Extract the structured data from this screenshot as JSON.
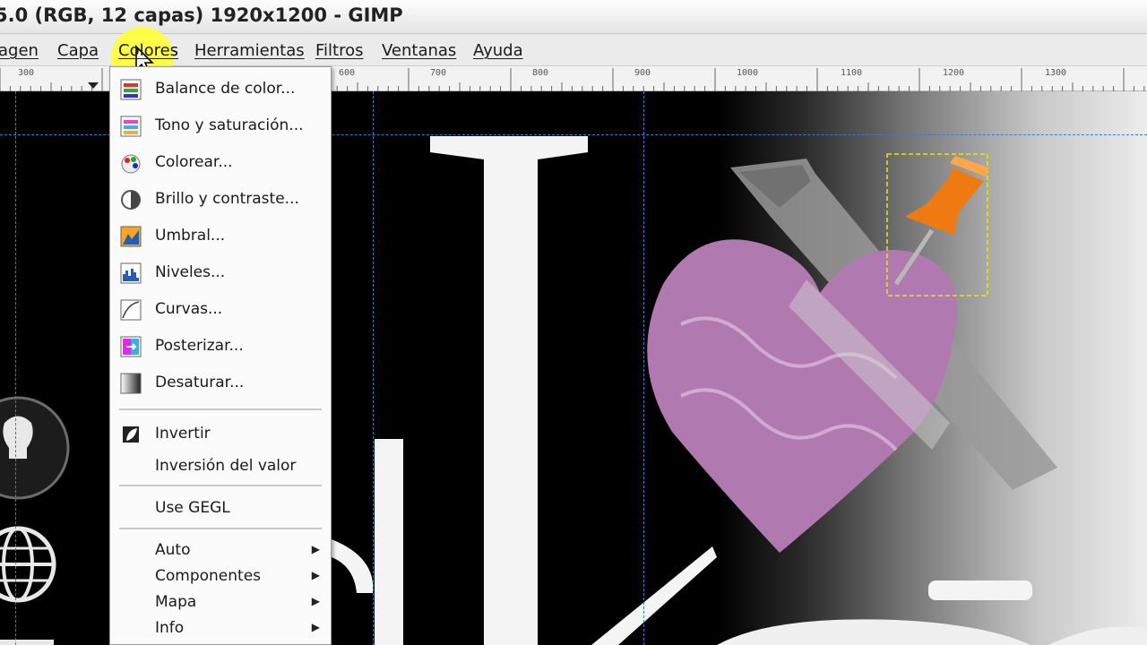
{
  "window": {
    "title": "5.0 (RGB, 12 capas) 1920x1200 - GIMP"
  },
  "menubar": {
    "items": [
      {
        "label": "agen"
      },
      {
        "label": "Capa"
      },
      {
        "label": "Colores"
      },
      {
        "label": "Herramientas"
      },
      {
        "label": "Filtros"
      },
      {
        "label": "Ventanas"
      },
      {
        "label": "Ayuda"
      }
    ]
  },
  "ruler": {
    "labels": [
      "300",
      "600",
      "700",
      "800",
      "900",
      "1000",
      "1100",
      "1200",
      "1300"
    ]
  },
  "colors_menu": {
    "items": [
      {
        "label": "Balance de color...",
        "icon": "color-balance-icon"
      },
      {
        "label": "Tono y saturación...",
        "icon": "hue-saturation-icon"
      },
      {
        "label": "Colorear...",
        "icon": "colorize-icon"
      },
      {
        "label": "Brillo y contraste...",
        "icon": "brightness-contrast-icon"
      },
      {
        "label": "Umbral...",
        "icon": "threshold-icon"
      },
      {
        "label": "Niveles...",
        "icon": "levels-icon"
      },
      {
        "label": "Curvas...",
        "icon": "curves-icon"
      },
      {
        "label": "Posterizar...",
        "icon": "posterize-icon"
      },
      {
        "label": "Desaturar...",
        "icon": "desaturate-icon"
      },
      {
        "label": "Invertir",
        "icon": "invert-icon"
      },
      {
        "label": "Inversión del valor"
      },
      {
        "label": "Use GEGL"
      },
      {
        "label": "Auto",
        "submenu": true
      },
      {
        "label": "Componentes",
        "submenu": true
      },
      {
        "label": "Mapa",
        "submenu": true
      },
      {
        "label": "Info",
        "submenu": true
      }
    ]
  },
  "theme": {
    "accent": "#2f7fd6",
    "highlight": "#ffff3c",
    "pin": "#f07a12",
    "heart": "#b07ab0"
  }
}
